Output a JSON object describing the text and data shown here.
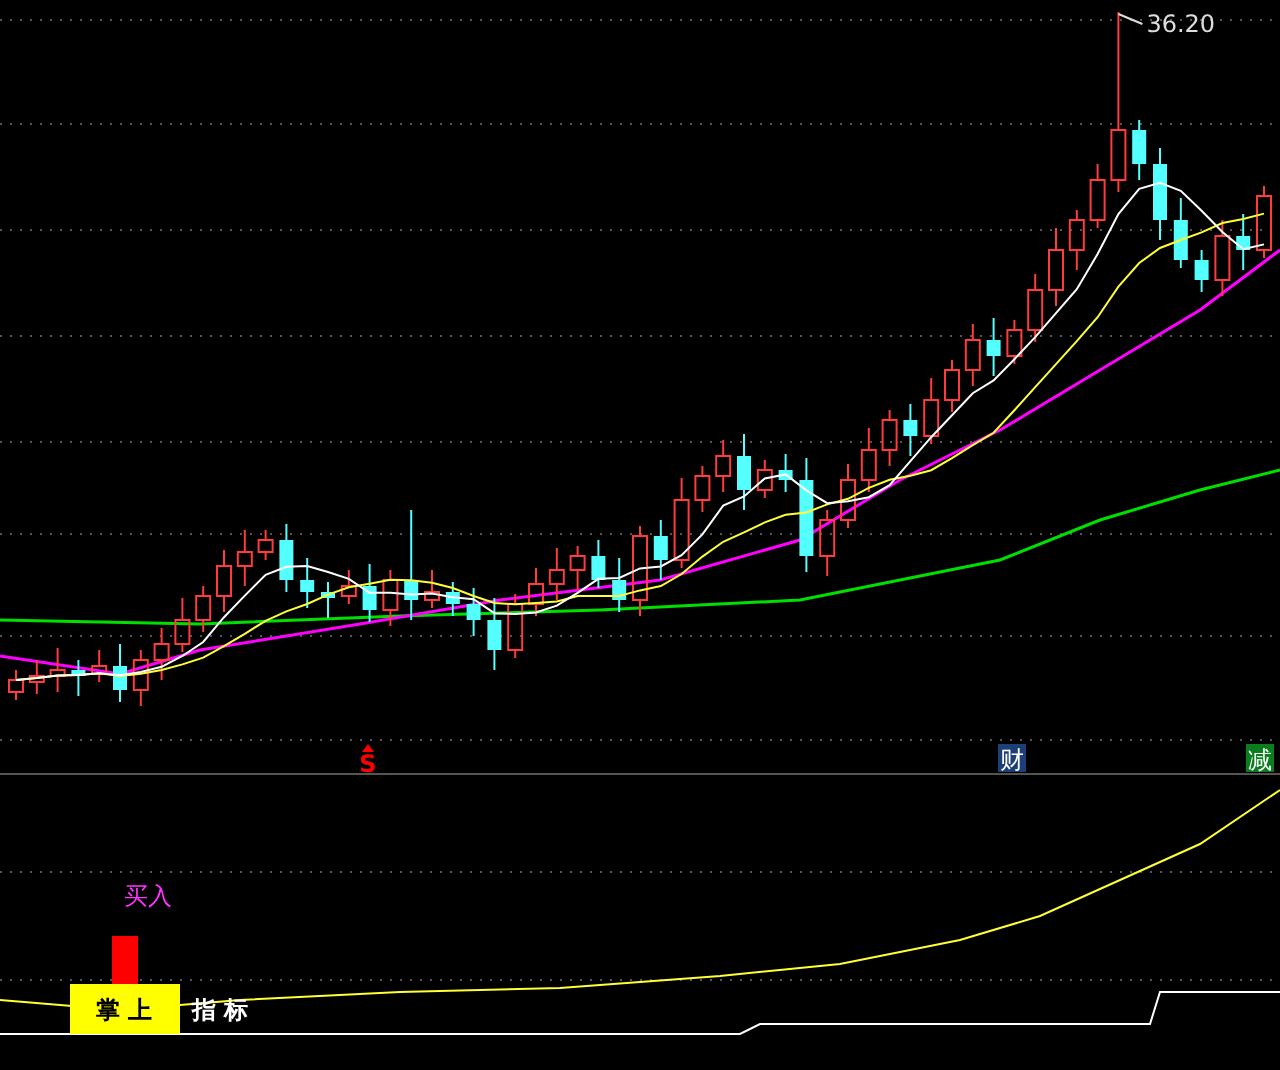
{
  "chart": {
    "high_label": "36.20"
  },
  "markers": [
    {
      "kind": "signal",
      "text": "S",
      "color": "#ff0000"
    },
    {
      "kind": "badge",
      "text": "财",
      "color": "#1c3f78"
    },
    {
      "kind": "badge",
      "text": "减",
      "color": "#0a7d1e"
    }
  ],
  "indicator": {
    "signal_text": "买入",
    "badge_text": "掌 上",
    "label": "指 标"
  }
}
